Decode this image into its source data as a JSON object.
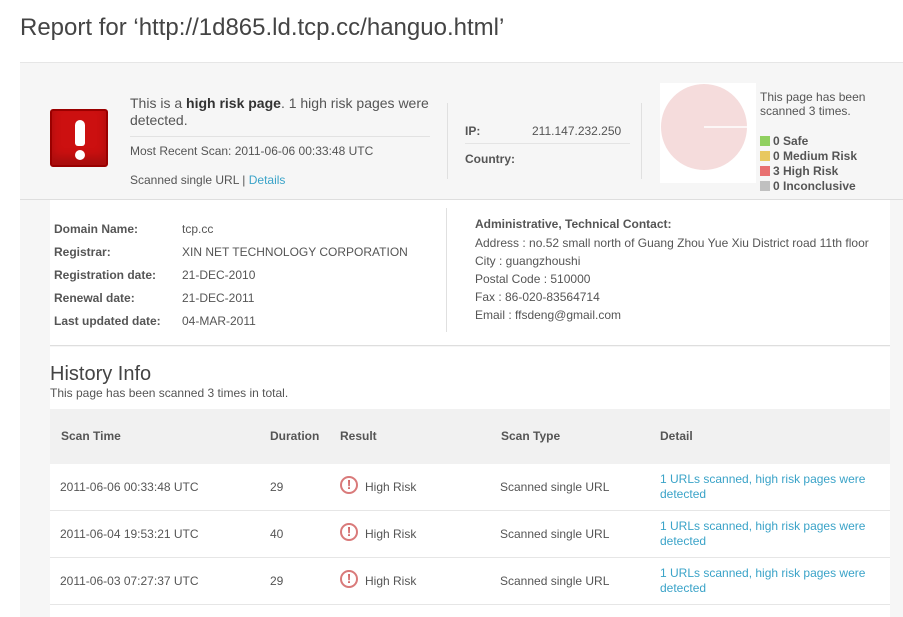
{
  "page": {
    "title": "Report for ‘http://1d865.ld.tcp.cc/hanguo.html’"
  },
  "summary": {
    "risk_prefix": "This is a ",
    "risk_bold": "high risk page",
    "risk_suffix": ". 1 high risk pages were detected.",
    "recent_scan": "Most Recent Scan: 2011-06-06 00:33:48 UTC",
    "scanned_type": "Scanned single URL | ",
    "details_link": "Details",
    "ip_label": "IP:",
    "ip_value": "211.147.232.250",
    "country_label": "Country:",
    "country_value": "",
    "scan_note": "This page has been scanned 3 times.",
    "legend": [
      {
        "label": "0 Safe",
        "color": "#90d060"
      },
      {
        "label": "0 Medium Risk",
        "color": "#e8c860"
      },
      {
        "label": "3 High Risk",
        "color": "#e87070"
      },
      {
        "label": "0 Inconclusive",
        "color": "#c0c0c0"
      }
    ],
    "pie_color": "#f5dcdc"
  },
  "whois": {
    "rows": [
      {
        "label": "Domain Name:",
        "value": "tcp.cc"
      },
      {
        "label": "Registrar:",
        "value": "XIN NET TECHNOLOGY CORPORATION"
      },
      {
        "label": "Registration date:",
        "value": "21-DEC-2010"
      },
      {
        "label": "Renewal date:",
        "value": "21-DEC-2011"
      },
      {
        "label": "Last updated date:",
        "value": "04-MAR-2011"
      }
    ],
    "contact_title": "Administrative, Technical Contact:",
    "contact_lines": [
      "Address : no.52 small north of Guang Zhou Yue Xiu District road 11th floor",
      "City : guangzhoushi",
      "Postal Code : 510000",
      "Fax : 86-020-83564714",
      "Email : ffsdeng@gmail.com"
    ]
  },
  "history": {
    "title": "History Info",
    "subtitle": "This page has been scanned 3 times in total.",
    "columns": [
      "Scan Time",
      "Duration",
      "Result",
      "Scan Type",
      "Detail"
    ],
    "rows": [
      {
        "time": "2011-06-06 00:33:48 UTC",
        "duration": "29",
        "result": "High Risk",
        "type": "Scanned single URL",
        "detail": "1 URLs scanned, high risk pages were detected"
      },
      {
        "time": "2011-06-04 19:53:21 UTC",
        "duration": "40",
        "result": "High Risk",
        "type": "Scanned single URL",
        "detail": "1 URLs scanned, high risk pages were detected"
      },
      {
        "time": "2011-06-03 07:27:37 UTC",
        "duration": "29",
        "result": "High Risk",
        "type": "Scanned single URL",
        "detail": "1 URLs scanned, high risk pages were detected"
      }
    ]
  }
}
